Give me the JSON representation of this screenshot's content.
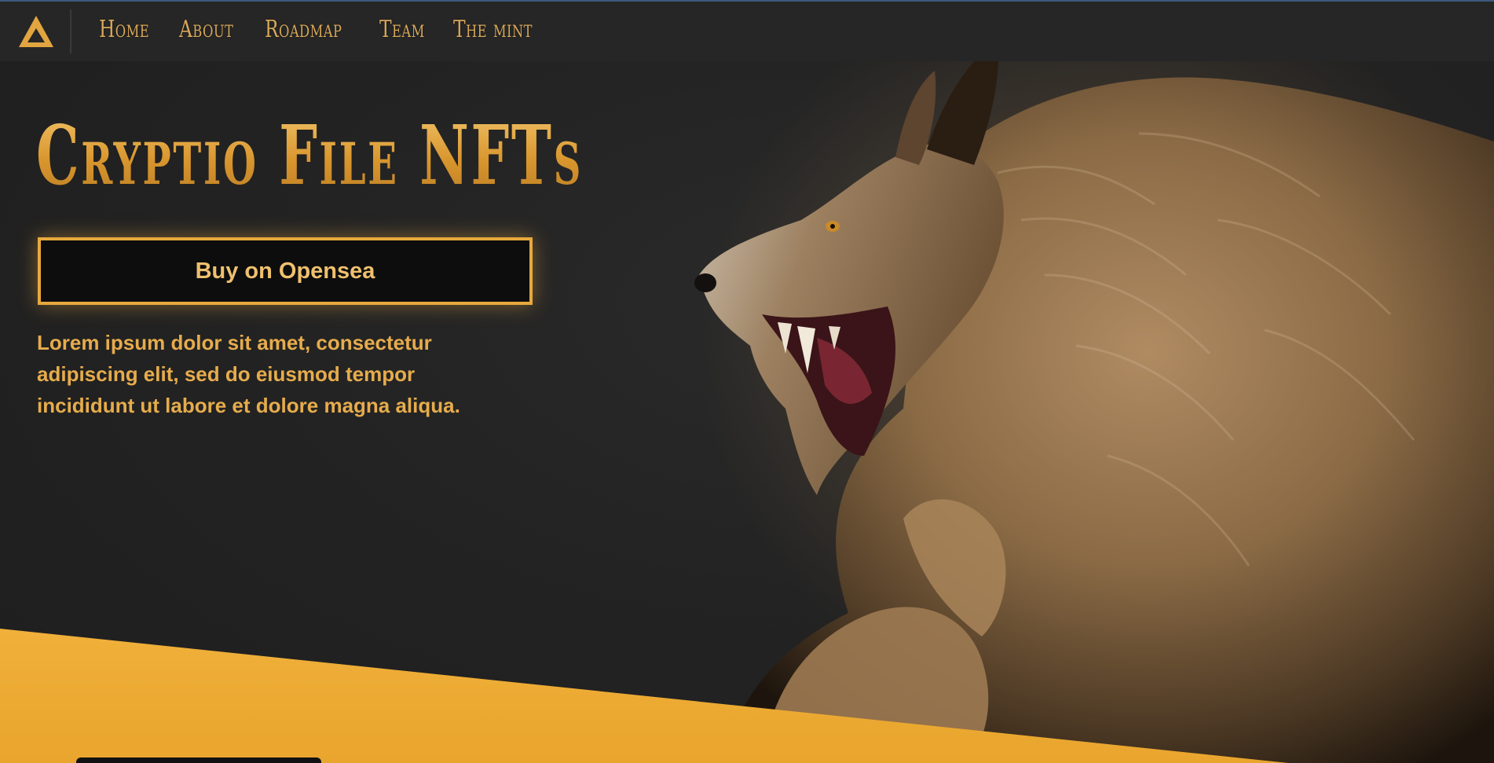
{
  "navbar": {
    "logo": "triangle-logo",
    "links": [
      "Home",
      "About",
      "Roadmap",
      "Team",
      "The mint"
    ]
  },
  "hero": {
    "title": "Cryptio File NFTs",
    "button_label": "Buy on Opensea",
    "description": "Lorem ipsum dolor sit amet, consectetur adipiscing elit, sed do eiusmod tempor incididunt ut labore et dolore magna aliqua.",
    "image": "werewolf-illustration"
  },
  "colors": {
    "accent": "#e7a93d",
    "background": "#222222",
    "band": "#eaa933"
  }
}
